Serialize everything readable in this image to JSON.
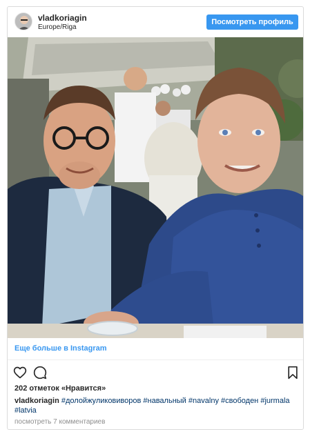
{
  "header": {
    "username": "vladkoriagin",
    "location": "Europe/Riga",
    "profile_button": "Посмотреть профиль"
  },
  "media": {
    "icon": "photo"
  },
  "more_link": "Еще больше в Instagram",
  "actions": {
    "like_icon": "heart-icon",
    "comment_icon": "comment-icon",
    "save_icon": "bookmark-icon"
  },
  "likes": "202 отметок «Нравится»",
  "caption": {
    "username": "vladkoriagin",
    "hashtags": [
      "#долойжуликовиворов",
      "#навальный",
      "#navalny",
      "#свободен",
      "#jurmala",
      "#latvia"
    ]
  },
  "comments_link": "посмотреть 7 комментариев",
  "colors": {
    "accent": "#3897f0",
    "hashtag": "#003569",
    "muted": "#8e8e8e",
    "border": "#dbdbdb"
  }
}
